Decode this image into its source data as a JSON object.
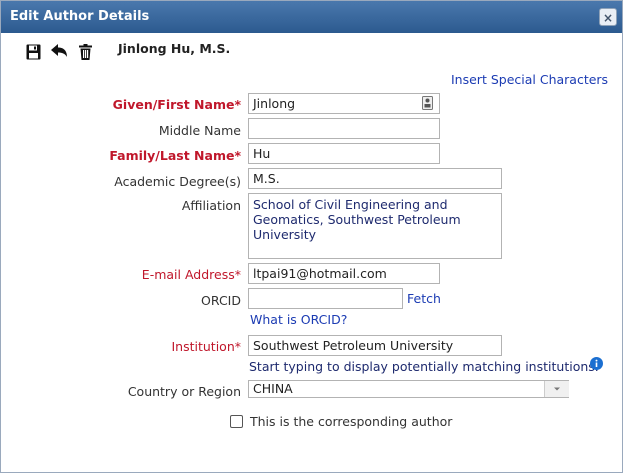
{
  "dialog": {
    "title": "Edit Author Details",
    "close_icon": "×",
    "toolbar": {
      "save_icon": "save-icon",
      "undo_icon": "undo-icon",
      "delete_icon": "trash-icon"
    },
    "author_heading": "Jinlong Hu, M.S."
  },
  "form": {
    "insert_special_chars": "Insert Special Characters",
    "given_name": {
      "label": "Given/First Name",
      "value": "Jinlong"
    },
    "middle_name": {
      "label": "Middle Name",
      "value": ""
    },
    "family_name": {
      "label": "Family/Last Name",
      "value": "Hu"
    },
    "academic_degree": {
      "label": "Academic Degree(s)",
      "value": "M.S."
    },
    "affiliation": {
      "label": "Affiliation",
      "value": "School of Civil Engineering and Geomatics, Southwest Petroleum University"
    },
    "email": {
      "label": "E-mail Address",
      "value": "ltpai91@hotmail.com"
    },
    "orcid": {
      "label": "ORCID",
      "value": "",
      "fetch": "Fetch",
      "what_is": "What is ORCID?"
    },
    "institution": {
      "label": "Institution",
      "value": "Southwest Petroleum University",
      "help": "Start typing to display potentially matching institutions."
    },
    "country": {
      "label": "Country or Region",
      "value": "CHINA"
    },
    "corresponding": {
      "label": "This is the corresponding author",
      "checked": false
    },
    "required_marker": "*"
  },
  "colors": {
    "titlebar": "#2c5a8f",
    "required": "#c0172b",
    "link": "#1b3bb3"
  }
}
